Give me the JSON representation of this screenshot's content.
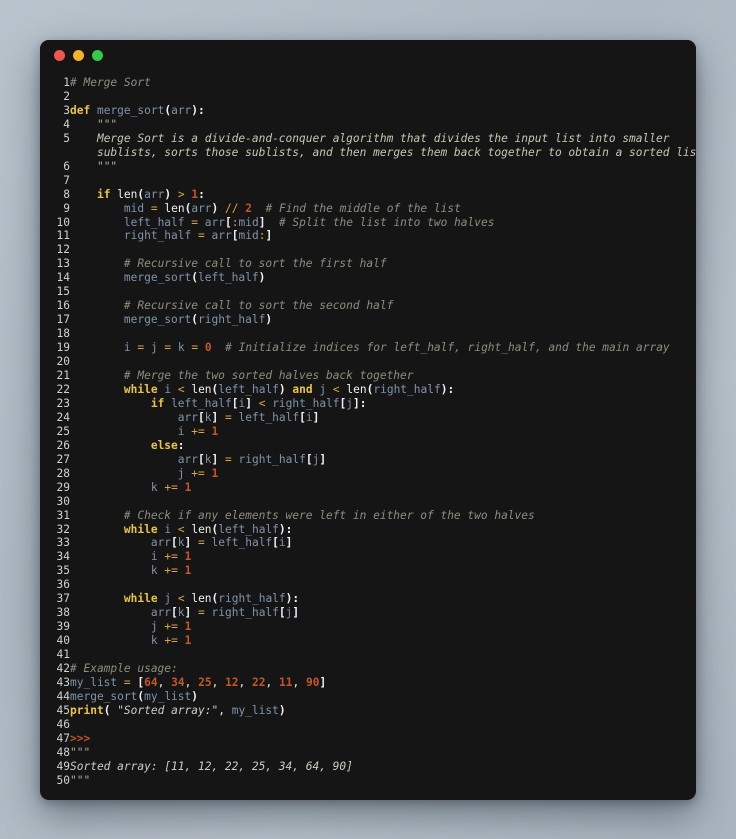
{
  "window": {
    "chrome": {
      "close_label": "close",
      "minimize_label": "minimize",
      "maximize_label": "maximize"
    },
    "background_color": "#151515",
    "desktop_color": "#b2bcc6"
  },
  "editor": {
    "language": "python",
    "total_lines": 50,
    "line_numbers": [
      "1",
      "2",
      "3",
      "4",
      "5",
      "",
      "6",
      "7",
      "8",
      "9",
      "10",
      "11",
      "12",
      "13",
      "14",
      "15",
      "16",
      "17",
      "18",
      "19",
      "20",
      "21",
      "22",
      "23",
      "24",
      "25",
      "26",
      "27",
      "28",
      "29",
      "30",
      "31",
      "32",
      "33",
      "34",
      "35",
      "36",
      "37",
      "38",
      "39",
      "40",
      "41",
      "42",
      "43",
      "44",
      "45",
      "46",
      "47",
      "48",
      "49",
      "50"
    ],
    "lines": [
      "# Merge Sort",
      "",
      "def merge_sort(arr):",
      "    \"\"\"",
      "    Merge Sort is a divide-and-conquer algorithm that divides the input list into smaller",
      "    sublists, sorts those sublists, and then merges them back together to obtain a sorted list.",
      "    \"\"\"",
      "",
      "    if len(arr) > 1:",
      "        mid = len(arr) // 2  # Find the middle of the list",
      "        left_half = arr[:mid]  # Split the list into two halves",
      "        right_half = arr[mid:]",
      "",
      "        # Recursive call to sort the first half",
      "        merge_sort(left_half)",
      "",
      "        # Recursive call to sort the second half",
      "        merge_sort(right_half)",
      "",
      "        i = j = k = 0  # Initialize indices for left_half, right_half, and the main array",
      "",
      "        # Merge the two sorted halves back together",
      "        while i < len(left_half) and j < len(right_half):",
      "            if left_half[i] < right_half[j]:",
      "                arr[k] = left_half[i]",
      "                i += 1",
      "            else:",
      "                arr[k] = right_half[j]",
      "                j += 1",
      "            k += 1",
      "",
      "        # Check if any elements were left in either of the two halves",
      "        while i < len(left_half):",
      "            arr[k] = left_half[i]",
      "            i += 1",
      "            k += 1",
      "",
      "        while j < len(right_half):",
      "            arr[k] = right_half[j]",
      "            j += 1",
      "            k += 1",
      "",
      "# Example usage:",
      "my_list = [64, 34, 25, 12, 22, 11, 90]",
      "merge_sort(my_list)",
      "print(\"Sorted array:\", my_list)",
      "",
      ">>>",
      "\"\"\"",
      "Sorted array: [11, 12, 22, 25, 34, 64, 90]",
      "\"\"\""
    ],
    "input_list": [
      64,
      34,
      25,
      12,
      22,
      11,
      90
    ],
    "sorted_list": [
      11,
      12,
      22,
      25,
      34,
      64,
      90
    ],
    "output_text": "Sorted array: [11, 12, 22, 25, 34, 64, 90]",
    "prompt_marker": ">>>",
    "print_label": "print",
    "print_string": "\"Sorted array:\"",
    "function_name": "merge_sort",
    "docstring_line_1": "Merge Sort is a divide-and-conquer algorithm that divides the input list into smaller",
    "docstring_line_2": "sublists, sorts those sublists, and then merges them back together to obtain a sorted list.",
    "comments": {
      "title": "# Merge Sort",
      "find_middle": "# Find the middle of the list",
      "split_list": "# Split the list into two halves",
      "recursive_first": "# Recursive call to sort the first half",
      "recursive_second": "# Recursive call to sort the second half",
      "init_indices": "# Initialize indices for left_half, right_half, and the main array",
      "merge_halves": "# Merge the two sorted halves back together",
      "check_left": "# Check if any elements were left in either of the two halves",
      "example_usage": "# Example usage:"
    },
    "colors": {
      "background": "#151515",
      "keyword": "#e8c547",
      "comment": "#8d8d7e",
      "docstring": "#c2c9b0",
      "identifier": "#7f94aa",
      "number": "#c4562a",
      "operator": "#d9a441",
      "plain": "#e6e6e6",
      "line_number": "#d2d2d2"
    }
  }
}
